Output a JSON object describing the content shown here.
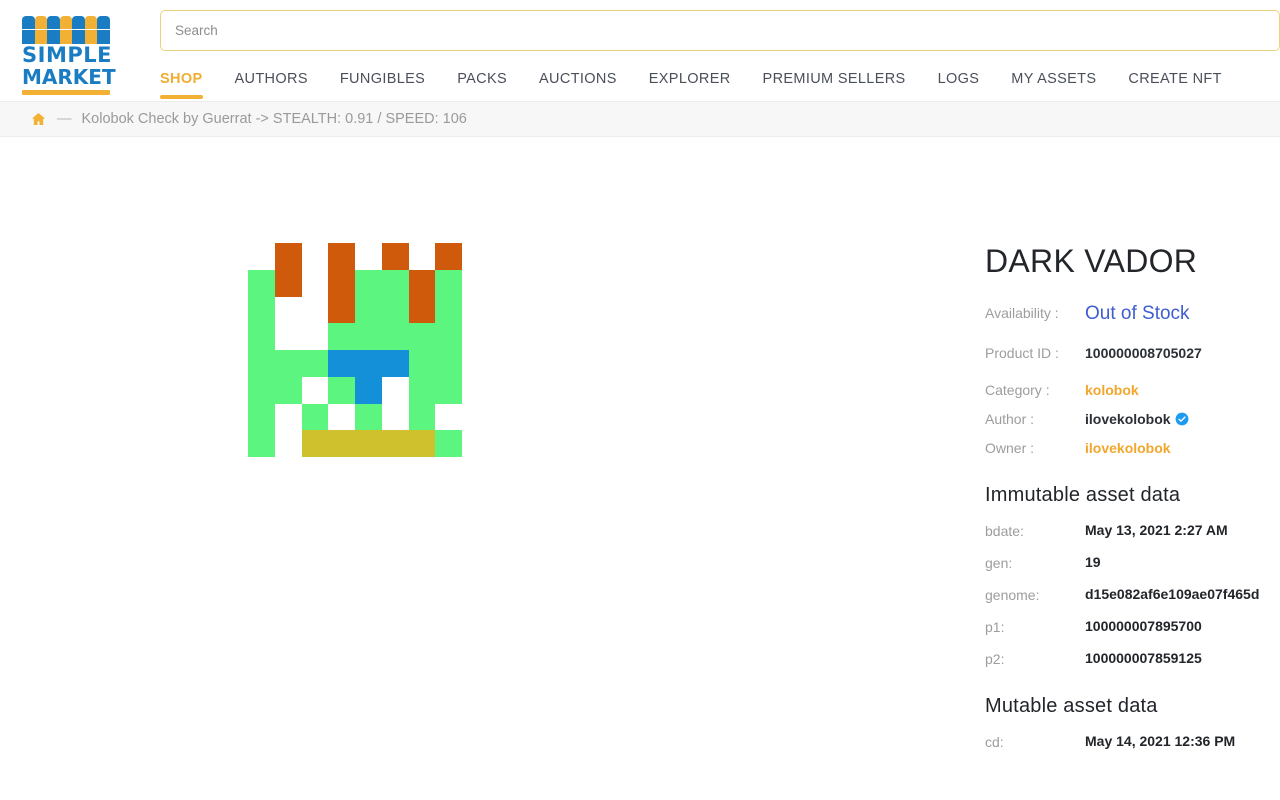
{
  "brand": {
    "name_line1": "SIMPLE",
    "name_line2": "MARKET"
  },
  "search": {
    "placeholder": "Search",
    "value": ""
  },
  "nav": {
    "items": [
      {
        "label": "SHOP",
        "active": true
      },
      {
        "label": "AUTHORS",
        "active": false
      },
      {
        "label": "FUNGIBLES",
        "active": false
      },
      {
        "label": "PACKS",
        "active": false
      },
      {
        "label": "AUCTIONS",
        "active": false
      },
      {
        "label": "EXPLORER",
        "active": false
      },
      {
        "label": "PREMIUM SELLERS",
        "active": false
      },
      {
        "label": "LOGS",
        "active": false
      },
      {
        "label": "MY ASSETS",
        "active": false
      },
      {
        "label": "CREATE NFT",
        "active": false
      }
    ]
  },
  "breadcrumb": {
    "home_icon": "home-icon",
    "separator": "—",
    "text": "Kolobok Check by Guerrat -> STEALTH: 0.91 / SPEED: 106"
  },
  "asset": {
    "title": "DARK VADOR",
    "availability_label": "Availability :",
    "availability_value": "Out of Stock",
    "product_id_label": "Product ID :",
    "product_id_value": "100000008705027",
    "category_label": "Category :",
    "category_value": "kolobok",
    "author_label": "Author :",
    "author_value": "ilovekolobok",
    "author_verified": true,
    "owner_label": "Owner :",
    "owner_value": "ilovekolobok"
  },
  "immutable": {
    "heading": "Immutable asset data",
    "rows": [
      {
        "key": "bdate:",
        "value": "May 13, 2021 2:27 AM"
      },
      {
        "key": "gen:",
        "value": "19"
      },
      {
        "key": "genome:",
        "value": "d15e082af6e109ae07f465d"
      },
      {
        "key": "p1:",
        "value": "100000007895700"
      },
      {
        "key": "p2:",
        "value": "100000007859125"
      }
    ]
  },
  "mutable": {
    "heading": "Mutable asset data",
    "rows": [
      {
        "key": "cd:",
        "value": "May 14, 2021 12:36 PM"
      }
    ]
  },
  "colors": {
    "brand_blue": "#1a7dc4",
    "brand_yellow": "#f2b134",
    "link_orange": "#f2a72c",
    "availability_blue": "#3f5dd1",
    "verified_blue": "#1d9bf0",
    "art_green": "#5bf580",
    "art_orange": "#cf5a0c",
    "art_blue": "#1490d8",
    "art_yellow": "#cfc02e",
    "art_empty": "#ffffff"
  },
  "nft_art": {
    "cols": 8,
    "rows": 8,
    "legend": {
      "g": "#5bf580",
      "o": "#cf5a0c",
      "b": "#1490d8",
      "y": "#cfc02e",
      "_": "#ffffff"
    },
    "grid": [
      [
        "_",
        "o",
        "_",
        "o",
        "_",
        "o",
        "_",
        "o"
      ],
      [
        "g",
        "o",
        "_",
        "o",
        "g",
        "g",
        "o",
        "g"
      ],
      [
        "g",
        "_",
        "_",
        "o",
        "g",
        "g",
        "o",
        "g"
      ],
      [
        "g",
        "_",
        "_",
        "g",
        "g",
        "g",
        "g",
        "g"
      ],
      [
        "g",
        "g",
        "g",
        "b",
        "b",
        "b",
        "g",
        "g"
      ],
      [
        "g",
        "g",
        "_",
        "g",
        "b",
        "_",
        "g",
        "g"
      ],
      [
        "g",
        "_",
        "g",
        "_",
        "g",
        "_",
        "g",
        "_"
      ],
      [
        "g",
        "_",
        "y",
        "y",
        "y",
        "y",
        "y",
        "g"
      ]
    ]
  }
}
